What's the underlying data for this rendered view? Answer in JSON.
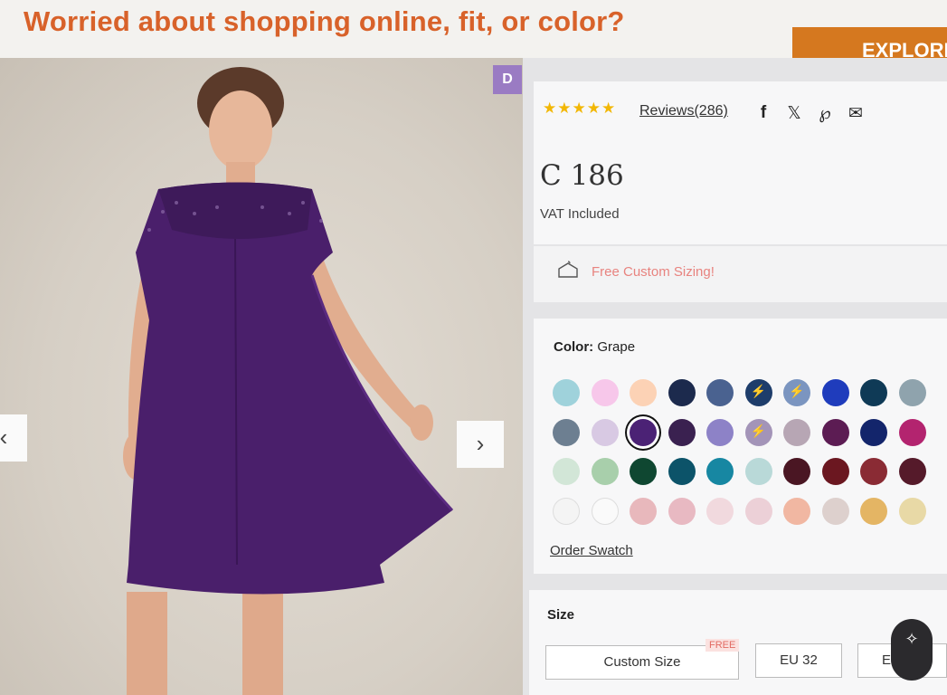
{
  "banner": {
    "text": "Worried about shopping online, fit, or color?",
    "explore_label": "EXPLORE"
  },
  "gallery": {
    "badge": "D",
    "prev_icon": "‹",
    "next_icon": "›"
  },
  "rating": {
    "stars": "★★★★★",
    "value": 4.5,
    "reviews": "Reviews(286)"
  },
  "share": {
    "facebook": "f",
    "x": "𝕏",
    "pinterest": "℘",
    "email": "✉"
  },
  "price": {
    "amount": "C 186",
    "vat": "VAT Included"
  },
  "promo": {
    "custom_sizing": "Free Custom Sizing!"
  },
  "color": {
    "label": "Color:",
    "selected": "Grape",
    "order_swatch": "Order Swatch",
    "swatches": [
      "#9fd2db",
      "#f7c7ea",
      "#fcd2b5",
      "#1c2a4d",
      "#4a6290",
      "#1e3d6b",
      "#7b95c0",
      "#1f3cbc",
      "#0f3a56",
      "#8fa3ad",
      "#6d7f91",
      "#d8c9e3",
      "#4b2275",
      "#3a2150",
      "#8d82c7",
      "#a394b8",
      "#b7a6b4",
      "#5c1c53",
      "#13256b",
      "#b3246f",
      "#d2e6d7",
      "#a8cfab",
      "#0f4731",
      "#0c5369",
      "#1787a2",
      "#b9d9d8",
      "#4a1623",
      "#6b1720",
      "#8a2b34",
      "#551a2a",
      "#f4f4f4",
      "#fafafa",
      "#e8b8bc",
      "#e8b9c2",
      "#f1d9de",
      "#ecd0d7",
      "#f1b7a2",
      "#ddd0cd",
      "#e4b564",
      "#e8d9a6"
    ]
  },
  "size": {
    "label": "Size",
    "custom": "Custom Size",
    "free_tag": "FREE",
    "eu32": "EU 32",
    "eu34": "EU"
  },
  "assistant": {
    "icon": "✧"
  }
}
